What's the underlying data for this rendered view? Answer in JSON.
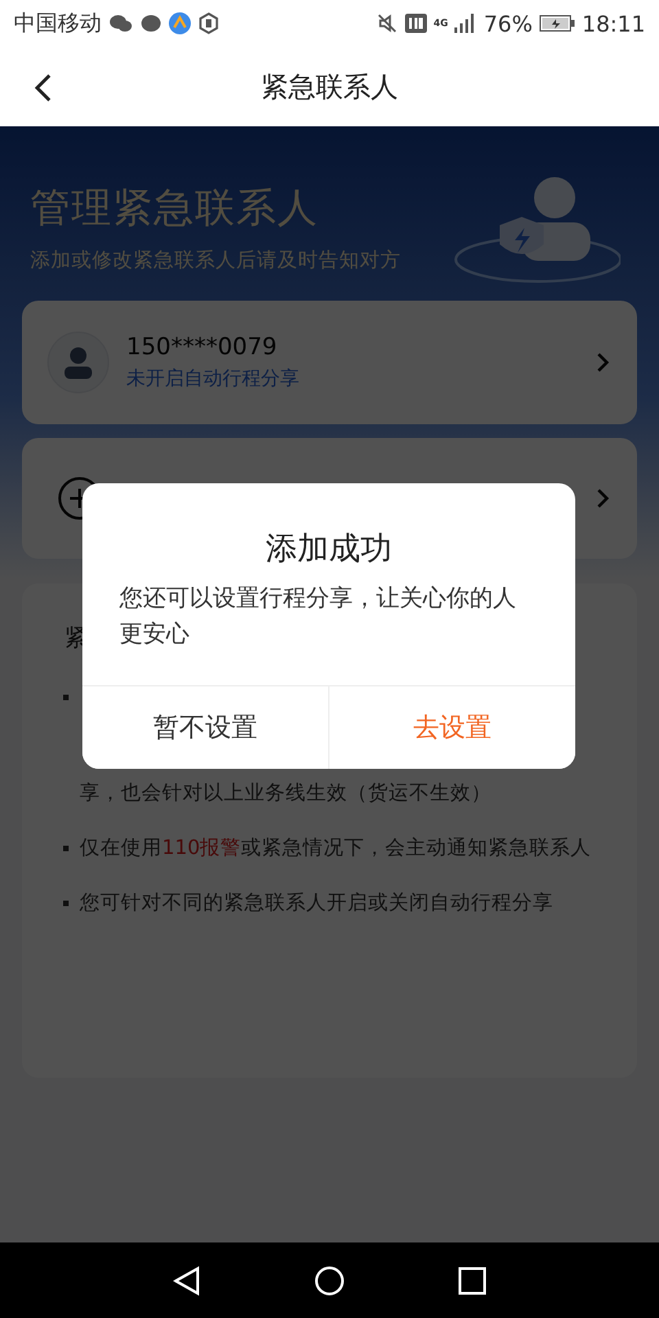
{
  "status_bar": {
    "carrier": "中国移动",
    "network": "4G",
    "battery": "76%",
    "time": "18:11"
  },
  "nav_bar": {
    "title": "紧急联系人"
  },
  "header": {
    "title": "管理紧急联系人",
    "subtitle": "添加或修改紧急联系人后请及时告知对方"
  },
  "contacts": [
    {
      "phone": "150****0079",
      "share_status": "未开启自动行程分享"
    }
  ],
  "notice": {
    "heading": "紧",
    "bullets": [
      {
        "parts": [
          {
            "text": "享，也会针对以上业务线生效（货运不生效）",
            "kind": "plain"
          }
        ],
        "covered": true
      },
      {
        "parts": [
          {
            "text": "仅在使用",
            "kind": "plain"
          },
          {
            "text": "110报警",
            "kind": "alert"
          },
          {
            "text": "或紧急情况下，会主动通知紧急联系人",
            "kind": "plain"
          }
        ],
        "covered": false
      },
      {
        "parts": [
          {
            "text": "您可针对不同的紧急联系人开启或关闭自动行程分享",
            "kind": "plain"
          }
        ],
        "covered": false
      }
    ]
  },
  "dialog": {
    "title": "添加成功",
    "message": "您还可以设置行程分享，让关心你的人更安心",
    "buttons": [
      {
        "label": "暂不设置",
        "kind": "secondary"
      },
      {
        "label": "去设置",
        "kind": "primary"
      }
    ]
  }
}
